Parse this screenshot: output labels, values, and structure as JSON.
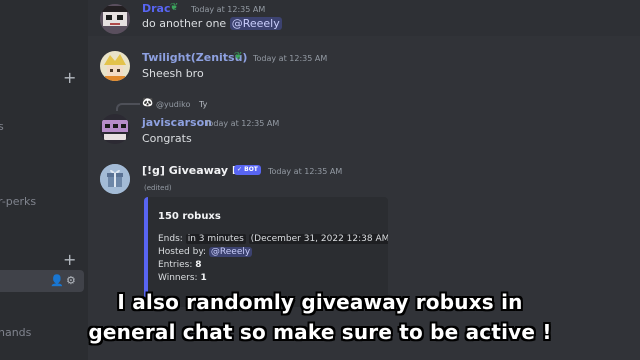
{
  "sidebar": {
    "fragments": [
      "s",
      "r-perks",
      "nands"
    ]
  },
  "messages": [
    {
      "author": "Drac",
      "author_color": "#5865f2",
      "timestamp": "Today at 12:35 AM",
      "text": "do another one",
      "mention": "@Reeely"
    },
    {
      "author": "Twilight(Zenitsu)",
      "author_color": "#8ea1e1",
      "timestamp": "Today at 12:35 AM",
      "text": "Sheesh bro"
    },
    {
      "reply_to": {
        "author": "@yudiko",
        "text": "Ty"
      },
      "author": "javiscarson",
      "author_color": "#8ea1e1",
      "timestamp": "Today at 12:35 AM",
      "text": "Congrats"
    },
    {
      "author": "[!g] Giveaway Bot",
      "author_color": "#f2f3f5",
      "bot_tag": "✓ BOT",
      "timestamp": "Today at 12:35 AM",
      "edited": "(edited)",
      "embed": {
        "title": "150 robuxs",
        "ends_label": "Ends:",
        "ends_value": "in 3 minutes",
        "ends_date": "(December 31, 2022 12:38 AM)",
        "hosted_label": "Hosted by:",
        "hosted_value": "@Reeely",
        "entries_label": "Entries:",
        "entries_value": "8",
        "winners_label": "Winners:",
        "winners_value": "1"
      }
    }
  ],
  "caption": {
    "line1": "I also randomly giveaway robuxs in",
    "line2": "general chat so make sure to be active !"
  },
  "colors": {
    "accent": "#5865f2",
    "background": "#313338"
  }
}
